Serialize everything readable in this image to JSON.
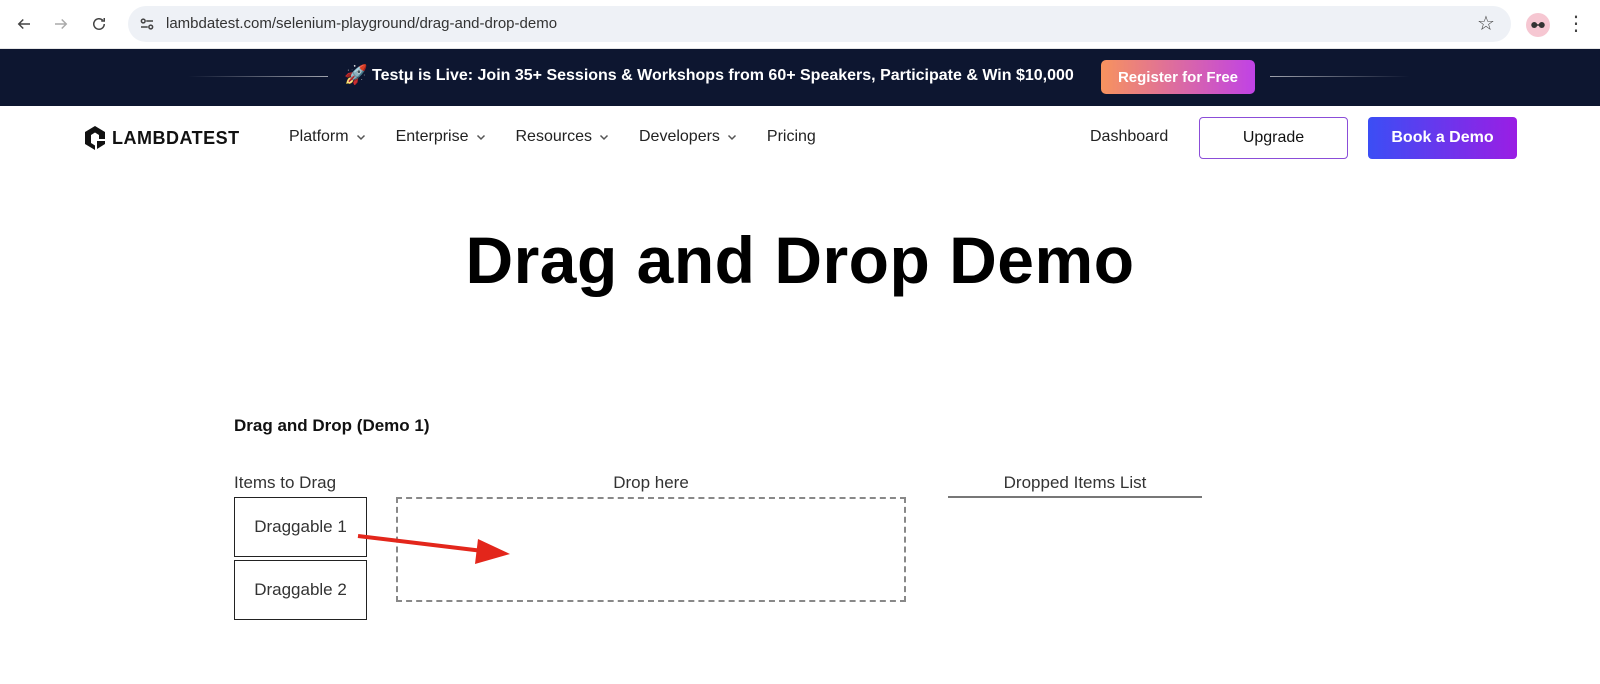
{
  "browser": {
    "url": "lambdatest.com/selenium-playground/drag-and-drop-demo"
  },
  "banner": {
    "text": "Testμ is Live: Join 35+ Sessions & Workshops from 60+ Speakers, Participate & Win $10,000",
    "cta_label": "Register for Free"
  },
  "nav": {
    "logo_text": "LAMBDATEST",
    "menu": [
      {
        "label": "Platform"
      },
      {
        "label": "Enterprise"
      },
      {
        "label": "Resources"
      },
      {
        "label": "Developers"
      },
      {
        "label": "Pricing"
      }
    ],
    "dashboard_label": "Dashboard",
    "upgrade_label": "Upgrade",
    "book_demo_label": "Book a Demo"
  },
  "page": {
    "title": "Drag and Drop Demo",
    "section_title": "Drag and Drop (Demo 1)",
    "items_label": "Items to Drag",
    "drop_label": "Drop here",
    "dropped_label": "Dropped Items List",
    "draggables": [
      {
        "label": "Draggable 1"
      },
      {
        "label": "Draggable 2"
      }
    ]
  },
  "colors": {
    "banner_bg": "#0d1630",
    "arrow": "#e3261b",
    "accent_start": "#3b4ef5",
    "accent_end": "#9a1ee4"
  }
}
